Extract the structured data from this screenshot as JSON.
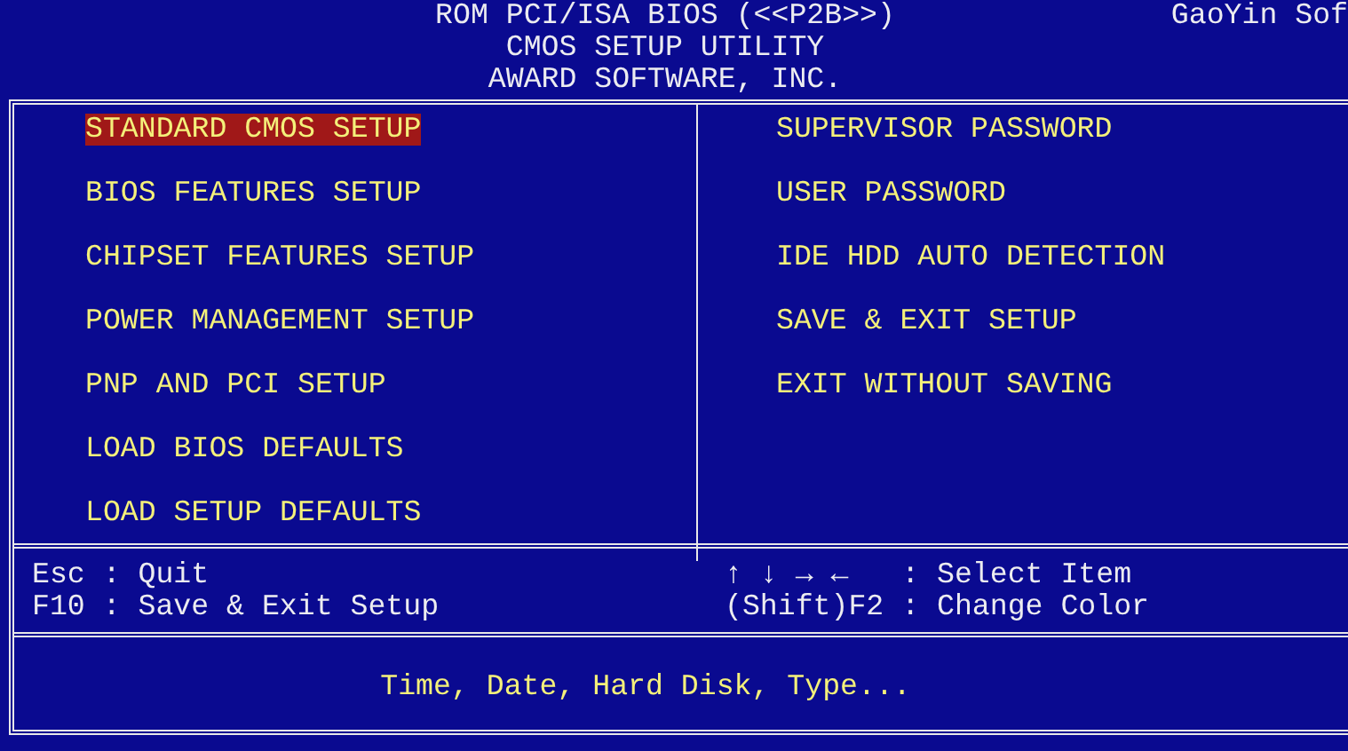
{
  "header": {
    "lines": [
      "ROM PCI/ISA BIOS (<<P2B>>)",
      "CMOS SETUP UTILITY",
      "AWARD SOFTWARE, INC."
    ],
    "corner_text": "GaoYin Sof"
  },
  "menu": {
    "left": [
      {
        "label": "STANDARD CMOS SETUP",
        "selected": true
      },
      {
        "label": "BIOS FEATURES SETUP",
        "selected": false
      },
      {
        "label": "CHIPSET FEATURES SETUP",
        "selected": false
      },
      {
        "label": "POWER MANAGEMENT SETUP",
        "selected": false
      },
      {
        "label": "PNP AND PCI SETUP",
        "selected": false
      },
      {
        "label": "LOAD BIOS DEFAULTS",
        "selected": false
      },
      {
        "label": "LOAD SETUP DEFAULTS",
        "selected": false
      }
    ],
    "right": [
      {
        "label": "SUPERVISOR PASSWORD",
        "selected": false
      },
      {
        "label": "USER PASSWORD",
        "selected": false
      },
      {
        "label": "IDE HDD AUTO DETECTION",
        "selected": false
      },
      {
        "label": "SAVE & EXIT SETUP",
        "selected": false
      },
      {
        "label": "EXIT WITHOUT SAVING",
        "selected": false
      }
    ]
  },
  "help": {
    "left": [
      "Esc : Quit",
      "F10 : Save & Exit Setup"
    ],
    "right": [
      "↑ ↓ → ←   : Select Item",
      "(Shift)F2 : Change Color"
    ]
  },
  "status": "Time, Date, Hard Disk, Type..."
}
